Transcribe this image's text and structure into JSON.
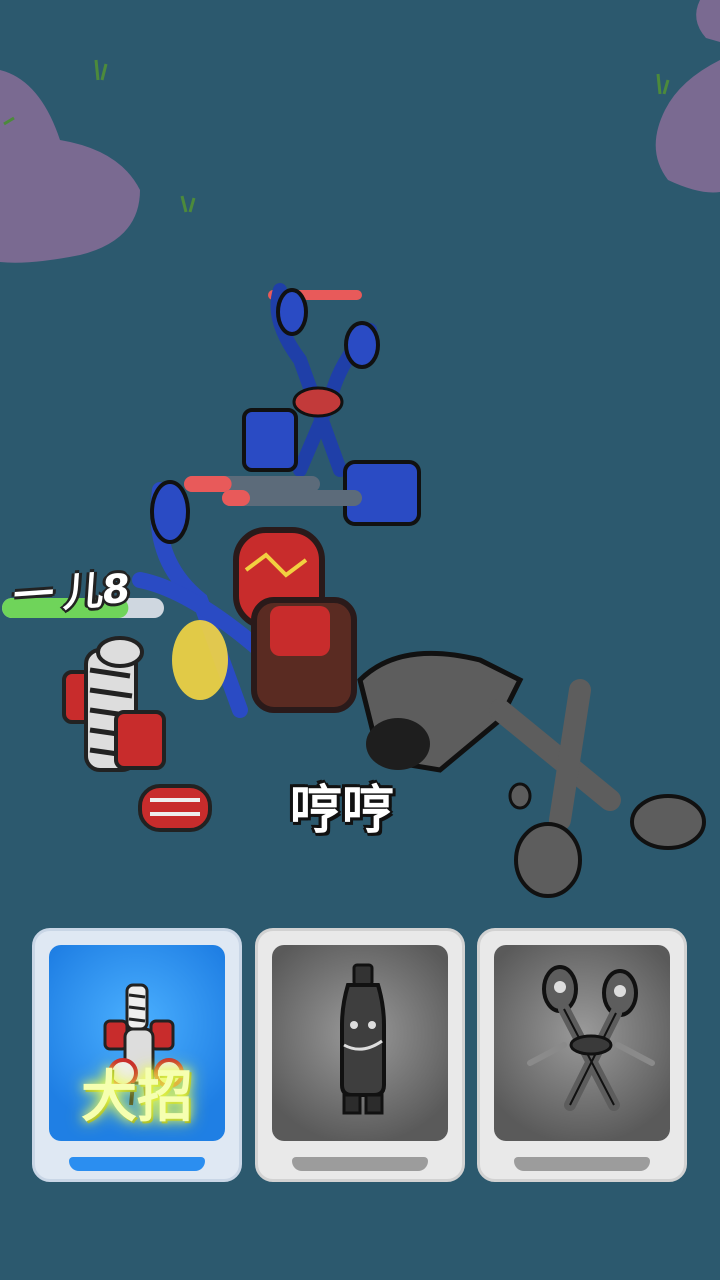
{
  "battle": {
    "damage_popup": "一 儿8",
    "taunt_popup": "哼哼"
  },
  "health": {
    "player": 0.78,
    "enemy_scissors": 1.0,
    "enemy_bottle_a": 0.35,
    "enemy_bottle_b": 0.2
  },
  "cards": [
    {
      "character": "zebra-speaker-fighter",
      "state": "selected",
      "ult_label": "大招"
    },
    {
      "character": "gray-bottle-fighter",
      "state": "locked"
    },
    {
      "character": "gray-scissors-fighter",
      "state": "locked"
    }
  ],
  "colors": {
    "background": "#2c596e",
    "health_green": "#6fd45a",
    "health_red": "#e85a5a",
    "selected_card": "#2b8ef0",
    "locked_card": "#8a8a8a"
  }
}
